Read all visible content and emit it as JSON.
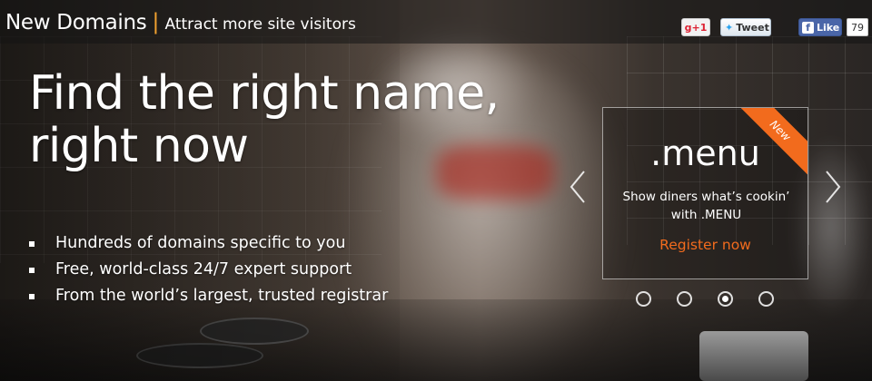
{
  "topbar": {
    "brand_title": "New Domains",
    "separator": "|",
    "tagline": "Attract more site visitors",
    "social": {
      "gplus_label": "+1",
      "tweet_label": "Tweet",
      "like_label": "Like",
      "like_count": "79"
    }
  },
  "hero": {
    "headline_line1": "Find the right name,",
    "headline_line2": "right now",
    "bullets": [
      "Hundreds of domains specific to you",
      "Free, world-class 24/7 expert support",
      "From the world’s largest, trusted registrar"
    ]
  },
  "promo": {
    "ribbon": "New",
    "tld": ".menu",
    "description": "Show diners what’s cookin’ with .MENU",
    "cta": "Register now"
  },
  "carousel": {
    "slide_count": 4,
    "active_index": 2
  },
  "colors": {
    "accent": "#f26b1d",
    "separator": "#f0a030",
    "facebook": "#4a66a8",
    "twitter": "#2aa3ef"
  }
}
